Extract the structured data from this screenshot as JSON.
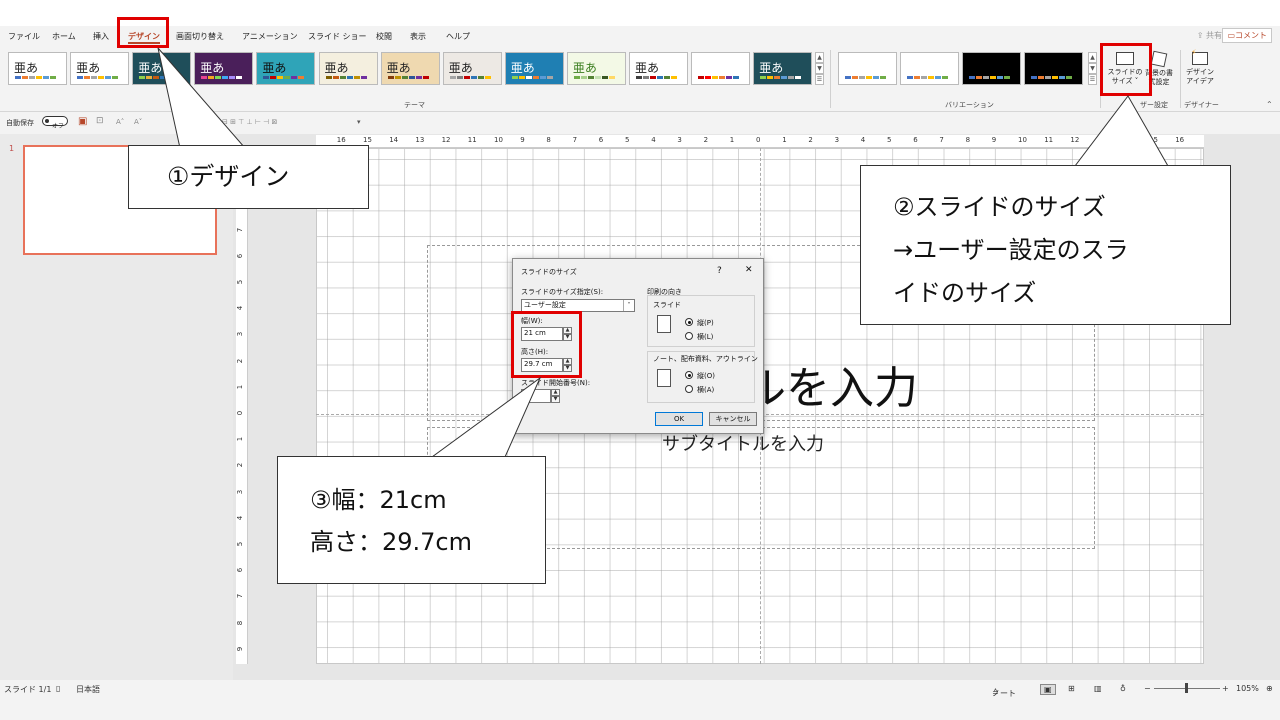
{
  "menu": {
    "tabs": [
      "ファイル",
      "ホーム",
      "挿入",
      "デザイン",
      "画面切り替え",
      "アニメーション",
      "スライド ショー",
      "校閲",
      "表示",
      "ヘルプ"
    ],
    "active_tab": "デザイン",
    "share": "共有",
    "comment": "コメント"
  },
  "ribbon": {
    "themes": [
      {
        "label": "亜あ",
        "bg": "#ffffff",
        "fg": "#222222",
        "bars": [
          "#4472c4",
          "#ed7d31",
          "#a5a5a5",
          "#ffc000",
          "#5b9bd5",
          "#70ad47"
        ]
      },
      {
        "label": "亜あ",
        "bg": "#ffffff",
        "fg": "#222222",
        "bars": [
          "#4472c4",
          "#ed7d31",
          "#a5a5a5",
          "#ffc000",
          "#5b9bd5",
          "#70ad47"
        ]
      },
      {
        "label": "亜あ",
        "bg": "#1f4e5a",
        "fg": "#ffffff",
        "bars": [
          "#8fd14f",
          "#e8b13b",
          "#c55a11",
          "#2e75b6",
          "#7f6000",
          "#a5a5a5"
        ]
      },
      {
        "label": "亜あ",
        "bg": "#4a1f5a",
        "fg": "#ffffff",
        "bars": [
          "#e84393",
          "#f6a623",
          "#7ed957",
          "#3fa9f5",
          "#a78bfa",
          "#ffffff"
        ]
      },
      {
        "label": "亜あ",
        "bg": "#2fa4b8",
        "fg": "#111111",
        "bars": [
          "#2f5597",
          "#c00000",
          "#ffc000",
          "#70ad47",
          "#7030a0",
          "#ed7d31"
        ]
      },
      {
        "label": "亜あ",
        "bg": "#f4efdf",
        "fg": "#222222",
        "bars": [
          "#7f6000",
          "#c55a11",
          "#548235",
          "#2e75b6",
          "#bf9000",
          "#7030a0"
        ]
      },
      {
        "label": "亜あ",
        "bg": "#efd9b0",
        "fg": "#222222",
        "bars": [
          "#843c0c",
          "#bf9000",
          "#548235",
          "#2f5597",
          "#7030a0",
          "#c00000"
        ]
      },
      {
        "label": "亜あ",
        "bg": "#ede9e4",
        "fg": "#222222",
        "bars": [
          "#a5a5a5",
          "#7f7f7f",
          "#c00000",
          "#2e75b6",
          "#548235",
          "#ffc000"
        ]
      },
      {
        "label": "亜あ",
        "bg": "#1f7fb3",
        "fg": "#ffffff",
        "bars": [
          "#8fd14f",
          "#ffc000",
          "#ffffff",
          "#ed7d31",
          "#5b9bd5",
          "#a5a5a5"
        ]
      },
      {
        "label": "亜あ",
        "bg": "#f3f9e6",
        "fg": "#3a7d1e",
        "bars": [
          "#70ad47",
          "#a9d18e",
          "#548235",
          "#c5e0b4",
          "#385723",
          "#ffd966"
        ]
      },
      {
        "label": "亜あ",
        "bg": "#ffffff",
        "fg": "#222222",
        "bars": [
          "#404040",
          "#7f7f7f",
          "#c00000",
          "#2e75b6",
          "#548235",
          "#ffc000"
        ]
      },
      {
        "label": "亜あ",
        "bg": "#ffffff",
        "fg": "#ffffff",
        "bars": [
          "#c00000",
          "#ff0000",
          "#ffc000",
          "#ed7d31",
          "#7030a0",
          "#2e75b6"
        ]
      },
      {
        "label": "亜あ",
        "bg": "#1f4e5a",
        "fg": "#ffffff",
        "bars": [
          "#8fd14f",
          "#ffc000",
          "#ed7d31",
          "#5b9bd5",
          "#a5a5a5",
          "#ffffff"
        ]
      }
    ],
    "theme_group_label": "テーマ",
    "variations": [
      {
        "bg": "#ffffff",
        "bars": [
          "#4472c4",
          "#ed7d31",
          "#a5a5a5",
          "#ffc000",
          "#5b9bd5",
          "#70ad47"
        ]
      },
      {
        "bg": "#ffffff",
        "bars": [
          "#4472c4",
          "#ed7d31",
          "#a5a5a5",
          "#ffc000",
          "#5b9bd5",
          "#70ad47"
        ]
      },
      {
        "bg": "#000000",
        "bars": [
          "#4472c4",
          "#ed7d31",
          "#a5a5a5",
          "#ffc000",
          "#5b9bd5",
          "#70ad47"
        ]
      },
      {
        "bg": "#000000",
        "bars": [
          "#4472c4",
          "#ed7d31",
          "#a5a5a5",
          "#ffc000",
          "#5b9bd5",
          "#70ad47"
        ]
      }
    ],
    "variation_group_label": "バリエーション",
    "slide_size_btn": [
      "スライドの",
      "サイズ ˅"
    ],
    "bg_format_btn": [
      "背景の書",
      "式設定"
    ],
    "user_settings_label": "ザー設定",
    "designer_btn": [
      "デザイン",
      "アイデア"
    ],
    "designer_label": "デザイナー"
  },
  "qat": {
    "autosave": "自動保存",
    "toggle": "オフ"
  },
  "thumbs": {
    "number": "1"
  },
  "slide": {
    "title_partial": "ルを入力",
    "subtitle": "サブタイトルを入力"
  },
  "hruler_labels": [
    "16",
    "15",
    "14",
    "13",
    "12",
    "11",
    "10",
    "9",
    "8",
    "7",
    "6",
    "5",
    "4",
    "3",
    "2",
    "1",
    "0",
    "1",
    "2",
    "3",
    "4",
    "5",
    "6",
    "7",
    "8",
    "9",
    "10",
    "11",
    "12",
    "13",
    "14",
    "15",
    "16"
  ],
  "vruler_labels": [
    "9",
    "8",
    "7",
    "6",
    "5",
    "4",
    "3",
    "2",
    "1",
    "0",
    "1",
    "2",
    "3",
    "4",
    "5",
    "6",
    "7",
    "8",
    "9"
  ],
  "dialog": {
    "title": "スライドのサイズ",
    "help": "?",
    "close": "✕",
    "size_label": "スライドのサイズ指定(S):",
    "size_value": "ユーザー設定",
    "width_label": "幅(W):",
    "width_value": "21 cm",
    "height_label": "高さ(H):",
    "height_value": "29.7 cm",
    "number_label": "スライド開始番号(N):",
    "number_value": "1",
    "orientation_label": "印刷の向き",
    "slides_label": "スライド",
    "portrait": "縦(P)",
    "landscape": "横(L)",
    "notes_label": "ノート、配布資料、アウトライン",
    "notes_portrait": "縦(O)",
    "notes_landscape": "横(A)",
    "ok": "OK",
    "cancel": "キャンセル"
  },
  "callouts": {
    "c1": "①デザイン",
    "c2_lines": [
      "②スライドのサイズ",
      "→ユーザー設定のスラ",
      "イドのサイズ"
    ],
    "c3_lines": [
      "③幅：21cm",
      "高さ：29.7cm"
    ]
  },
  "status": {
    "slide": "スライド 1/1",
    "lang": "日本語",
    "notes": "ノート",
    "zoom": "105%"
  },
  "colors": {
    "accent": "#b7472a",
    "highlight": "#e00000"
  }
}
